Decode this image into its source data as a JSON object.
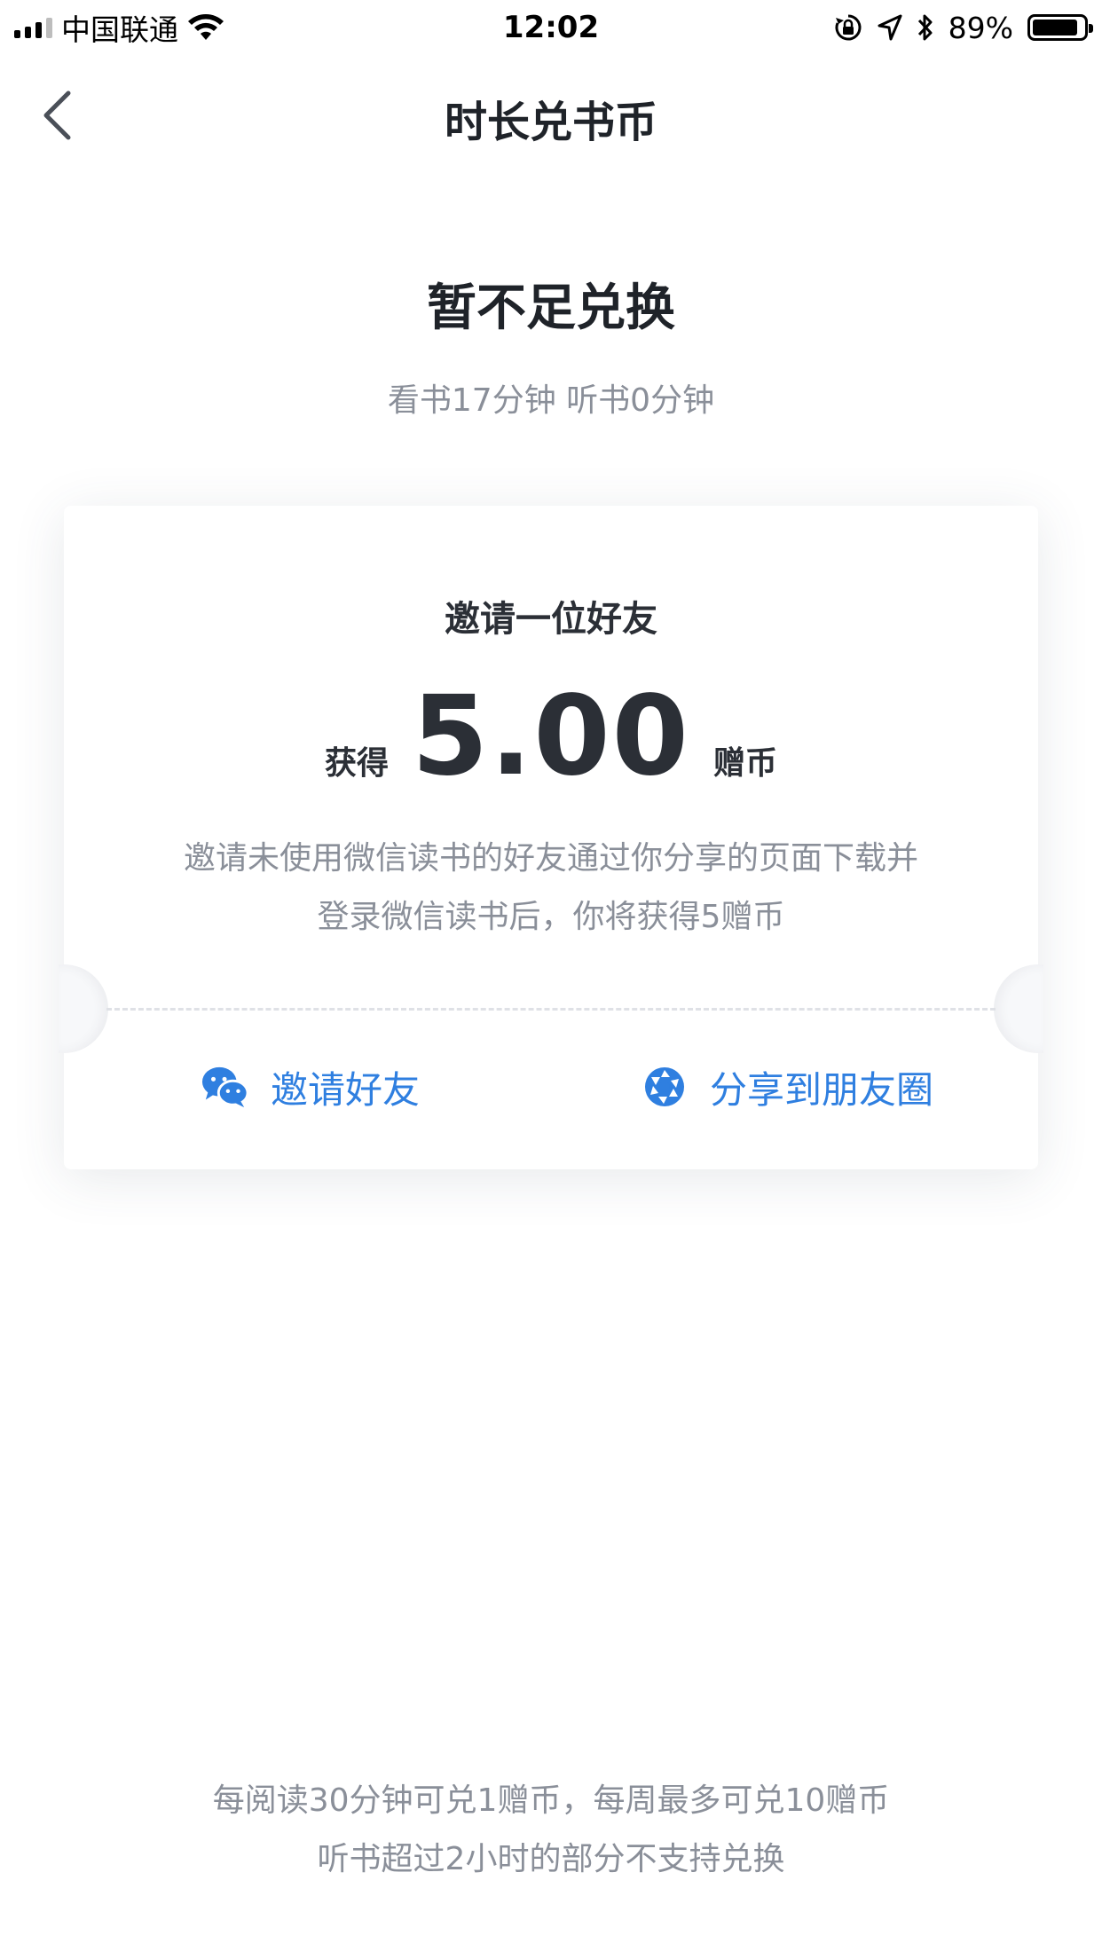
{
  "status_bar": {
    "carrier": "中国联通",
    "time": "12:02",
    "battery": "89%",
    "battery_level": 0.89
  },
  "nav": {
    "title": "时长兑书币",
    "back_icon": "chevron-left-icon"
  },
  "status": {
    "headline": "暂不足兑换",
    "subline": "看书17分钟 听书0分钟"
  },
  "card": {
    "title": "邀请一位好友",
    "reward_prefix": "获得",
    "reward_amount": "5.00",
    "reward_unit": "赠币",
    "desc_line1": "邀请未使用微信读书的好友通过你分享的页面下载并",
    "desc_line2": "登录微信读书后，你将获得5赠币",
    "actions": [
      {
        "label": "邀请好友",
        "icon": "wechat-icon"
      },
      {
        "label": "分享到朋友圈",
        "icon": "moments-shutter-icon"
      }
    ]
  },
  "footer": {
    "line1": "每阅读30分钟可兑1赠币，每周最多可兑10赠币",
    "line2": "听书超过2小时的部分不支持兑换"
  },
  "colors": {
    "accent": "#2f7fe0",
    "text_primary": "#1f2329",
    "text_secondary": "#8a8f99"
  }
}
